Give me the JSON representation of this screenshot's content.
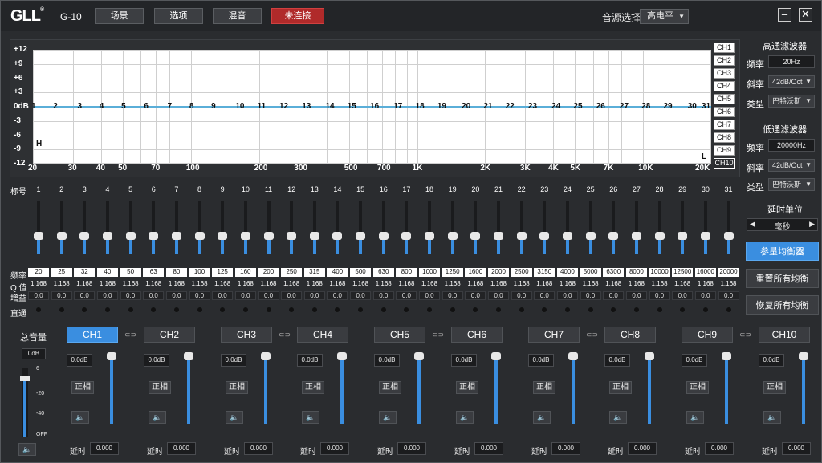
{
  "title_bar": {
    "logo": "GLL",
    "logo_mark": "®",
    "model": "G-10",
    "buttons": [
      "场景",
      "选项",
      "混音",
      "未连接"
    ],
    "source_label": "音源选择",
    "source_value": "高电平",
    "minimize_icon": "minimize-icon",
    "close_icon": "close-icon"
  },
  "graph": {
    "y_labels": [
      "+12",
      "+9",
      "+6",
      "+3",
      "0dB",
      "-3",
      "-6",
      "-9",
      "-12"
    ],
    "x_labels": [
      "20",
      "30",
      "40",
      "50",
      "70",
      "100",
      "200",
      "300",
      "500",
      "700",
      "1K",
      "2K",
      "3K",
      "4K",
      "5K",
      "7K",
      "10K",
      "20K"
    ],
    "band_markers": [
      "1",
      "2",
      "3",
      "4",
      "5",
      "6",
      "7",
      "8",
      "9",
      "10",
      "11",
      "12",
      "13",
      "14",
      "15",
      "16",
      "17",
      "18",
      "19",
      "20",
      "21",
      "22",
      "23",
      "24",
      "25",
      "26",
      "27",
      "28",
      "29",
      "30",
      "31"
    ],
    "h_marker": "H",
    "l_marker": "L",
    "curve_color": "#5aaed8",
    "channel_buttons": [
      "CH1",
      "CH2",
      "CH3",
      "CH4",
      "CH5",
      "CH6",
      "CH7",
      "CH8",
      "CH9",
      "CH10"
    ]
  },
  "right_panel": {
    "hpf_title": "高通滤波器",
    "hpf_freq_label": "频率",
    "hpf_freq": "20Hz",
    "hpf_slope_label": "斜率",
    "hpf_slope": "42dB/Oct",
    "hpf_type_label": "类型",
    "hpf_type": "巴特沃斯",
    "lpf_title": "低通滤波器",
    "lpf_freq_label": "频率",
    "lpf_freq": "20000Hz",
    "lpf_slope_label": "斜率",
    "lpf_slope": "42dB/Oct",
    "lpf_type_label": "类型",
    "lpf_type": "巴特沃斯",
    "delay_unit_label": "延时单位",
    "delay_unit": "毫秒",
    "eq_button": "参量均衡器",
    "reset_button": "重置所有均衡",
    "restore_button": "恢复所有均衡"
  },
  "bands": {
    "label_num": "标号",
    "label_freq": "频率",
    "label_q": "Q 值",
    "label_gain": "增益",
    "label_direct": "直通",
    "numbers": [
      "1",
      "2",
      "3",
      "4",
      "5",
      "6",
      "7",
      "8",
      "9",
      "10",
      "11",
      "12",
      "13",
      "14",
      "15",
      "16",
      "17",
      "18",
      "19",
      "20",
      "21",
      "22",
      "23",
      "24",
      "25",
      "26",
      "27",
      "28",
      "29",
      "30",
      "31"
    ],
    "freqs": [
      "20",
      "25",
      "32",
      "40",
      "50",
      "63",
      "80",
      "100",
      "125",
      "160",
      "200",
      "250",
      "315",
      "400",
      "500",
      "630",
      "800",
      "1000",
      "1250",
      "1600",
      "2000",
      "2500",
      "3150",
      "4000",
      "5000",
      "6300",
      "8000",
      "10000",
      "12500",
      "16000",
      "20000"
    ],
    "q": [
      "1.168",
      "1.168",
      "1.168",
      "1.168",
      "1.168",
      "1.168",
      "1.168",
      "1.168",
      "1.168",
      "1.168",
      "1.168",
      "1.168",
      "1.168",
      "1.168",
      "1.168",
      "1.168",
      "1.168",
      "1.168",
      "1.168",
      "1.168",
      "1.168",
      "1.168",
      "1.168",
      "1.168",
      "1.168",
      "1.168",
      "1.168",
      "1.168",
      "1.168",
      "1.168",
      "1.168"
    ],
    "gain": [
      "0.0",
      "0.0",
      "0.0",
      "0.0",
      "0.0",
      "0.0",
      "0.0",
      "0.0",
      "0.0",
      "0.0",
      "0.0",
      "0.0",
      "0.0",
      "0.0",
      "0.0",
      "0.0",
      "0.0",
      "0.0",
      "0.0",
      "0.0",
      "0.0",
      "0.0",
      "0.0",
      "0.0",
      "0.0",
      "0.0",
      "0.0",
      "0.0",
      "0.0",
      "0.0",
      "0.0"
    ],
    "slider_level": 0.5
  },
  "master": {
    "label": "总音量",
    "value": "0dB",
    "scale": [
      "6",
      "-20",
      "-40",
      "OFF"
    ],
    "level": 0.85
  },
  "channels": [
    {
      "name": "CH1",
      "vol": "0.0dB",
      "phase": "正相",
      "delay_label": "延时",
      "delay": "0.000",
      "link": true
    },
    {
      "name": "CH2",
      "vol": "0.0dB",
      "phase": "正相",
      "delay_label": "延时",
      "delay": "0.000",
      "link": false
    },
    {
      "name": "CH3",
      "vol": "0.0dB",
      "phase": "正相",
      "delay_label": "延时",
      "delay": "0.000",
      "link": true
    },
    {
      "name": "CH4",
      "vol": "0.0dB",
      "phase": "正相",
      "delay_label": "延时",
      "delay": "0.000",
      "link": false
    },
    {
      "name": "CH5",
      "vol": "0.0dB",
      "phase": "正相",
      "delay_label": "延时",
      "delay": "0.000",
      "link": true
    },
    {
      "name": "CH6",
      "vol": "0.0dB",
      "phase": "正相",
      "delay_label": "延时",
      "delay": "0.000",
      "link": false
    },
    {
      "name": "CH7",
      "vol": "0.0dB",
      "phase": "正相",
      "delay_label": "延时",
      "delay": "0.000",
      "link": true
    },
    {
      "name": "CH8",
      "vol": "0.0dB",
      "phase": "正相",
      "delay_label": "延时",
      "delay": "0.000",
      "link": false
    },
    {
      "name": "CH9",
      "vol": "0.0dB",
      "phase": "正相",
      "delay_label": "延时",
      "delay": "0.000",
      "link": true
    },
    {
      "name": "CH10",
      "vol": "0.0dB",
      "phase": "正相",
      "delay_label": "延时",
      "delay": "0.000",
      "link": false
    }
  ],
  "colors": {
    "accent": "#3a8ee0",
    "disconnected": "#b02a2a"
  }
}
